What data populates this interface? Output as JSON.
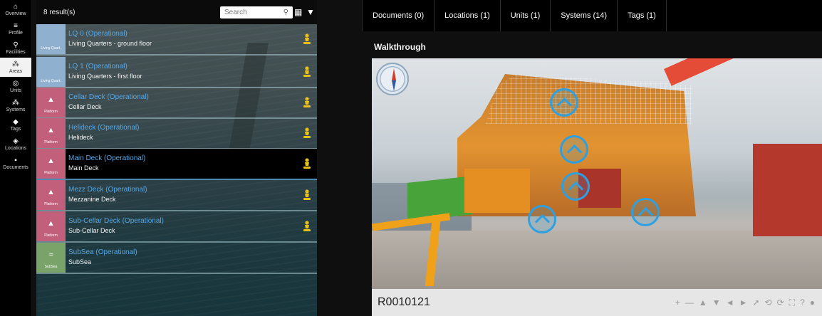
{
  "nav": {
    "items": [
      {
        "label": "Overview",
        "icon": "home-icon",
        "glyph": "⌂"
      },
      {
        "label": "Profile",
        "icon": "list-icon",
        "glyph": "≡"
      },
      {
        "label": "Facilities",
        "icon": "facility-icon",
        "glyph": "⚲"
      },
      {
        "label": "Areas",
        "icon": "areas-icon",
        "glyph": "⁂",
        "active": true
      },
      {
        "label": "Units",
        "icon": "units-icon",
        "glyph": "◎"
      },
      {
        "label": "Systems",
        "icon": "systems-icon",
        "glyph": "⁂"
      },
      {
        "label": "Tags",
        "icon": "tag-icon",
        "glyph": "◆"
      },
      {
        "label": "Locations",
        "icon": "location-icon",
        "glyph": "◈"
      },
      {
        "label": "Documents",
        "icon": "document-icon",
        "glyph": "▪"
      }
    ]
  },
  "results": {
    "count_label": "8 result(s)",
    "search_placeholder": "Search",
    "rows": [
      {
        "title": "LQ 0 (Operational)",
        "sub": "Living Quarters - ground floor",
        "type": "Living Quart.",
        "color": "#8fb0cf",
        "badge": true
      },
      {
        "title": "LQ 1 (Operational)",
        "sub": "Living Quarters - first floor",
        "type": "Living Quart.",
        "color": "#8fb0cf",
        "badge": true
      },
      {
        "title": "Cellar Deck (Operational)",
        "sub": "Cellar Deck",
        "type": "Platform",
        "color": "#c25f7a",
        "badge": true
      },
      {
        "title": "Helideck (Operational)",
        "sub": "Helideck",
        "type": "Platform",
        "color": "#c25f7a",
        "badge": true
      },
      {
        "title": "Main Deck (Operational)",
        "sub": "Main Deck",
        "type": "Platform",
        "color": "#c25f7a",
        "badge": true,
        "selected": true
      },
      {
        "title": "Mezz Deck (Operational)",
        "sub": "Mezzanine Deck",
        "type": "Platform",
        "color": "#c25f7a",
        "badge": true
      },
      {
        "title": "Sub-Cellar Deck (Operational)",
        "sub": "Sub-Cellar Deck",
        "type": "Platform",
        "color": "#c25f7a",
        "badge": true
      },
      {
        "title": "SubSea (Operational)",
        "sub": "SubSea",
        "type": "SubSea",
        "color": "#7aa36a",
        "badge": false
      }
    ]
  },
  "tabs": [
    {
      "label": "Documents (0)"
    },
    {
      "label": "Locations (1)"
    },
    {
      "label": "Units (1)"
    },
    {
      "label": "Systems (14)"
    },
    {
      "label": "Tags (1)"
    }
  ],
  "walkthrough": {
    "title": "Walkthrough",
    "viewpoint_id": "R0010121",
    "hotspot_count": 5
  },
  "viewer_controls": [
    {
      "name": "zoom-in-icon",
      "glyph": "+"
    },
    {
      "name": "zoom-out-icon",
      "glyph": "—"
    },
    {
      "name": "move-up-icon",
      "glyph": "▲"
    },
    {
      "name": "move-down-icon",
      "glyph": "▼"
    },
    {
      "name": "move-left-icon",
      "glyph": "◄"
    },
    {
      "name": "move-right-icon",
      "glyph": "►"
    },
    {
      "name": "pin-icon",
      "glyph": "➚"
    },
    {
      "name": "rotate-icon",
      "glyph": "⟲"
    },
    {
      "name": "autorotate-icon",
      "glyph": "⟳"
    },
    {
      "name": "fullscreen-icon",
      "glyph": "⛶"
    },
    {
      "name": "help-icon",
      "glyph": "?"
    },
    {
      "name": "info-icon",
      "glyph": "●"
    }
  ],
  "colors": {
    "accent_blue": "#55a8e8",
    "hotspot_blue": "#2e9fe0",
    "badge_yellow": "#e8c21a"
  }
}
